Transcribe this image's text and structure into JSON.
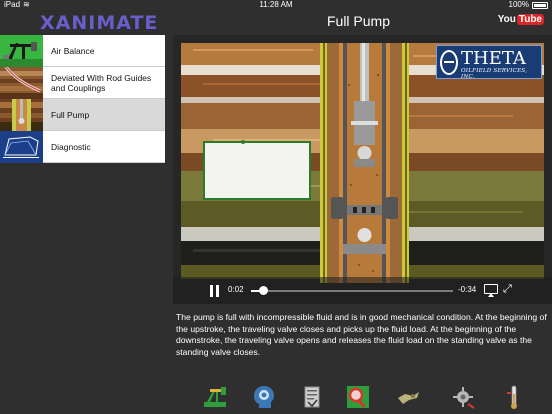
{
  "status": {
    "carrier": "iPad",
    "time": "11:28 AM",
    "battery": "100%"
  },
  "app": {
    "logo": "XANIMATE",
    "title": "Full Pump",
    "youtube_you": "You",
    "youtube_tube": "Tube"
  },
  "sidebar": {
    "items": [
      {
        "label": "Air Balance",
        "selected": false,
        "thumb_icon": "pump-jack-thumbnail"
      },
      {
        "label": "Deviated With Rod Guides and Couplings",
        "selected": false,
        "thumb_icon": "wellbore-thumbnail"
      },
      {
        "label": "Full Pump",
        "selected": true,
        "thumb_icon": "pump-thumbnail"
      },
      {
        "label": "Diagnostic",
        "selected": false,
        "thumb_icon": "dynagraph-thumbnail"
      }
    ]
  },
  "video": {
    "brand_big": "THETA",
    "brand_small": "OILFIELD SERVICES, INC.",
    "current_time": "0:02",
    "remaining_time": "-0:34",
    "progress": 0.06
  },
  "description": "The pump is full with incompressible fluid and is in good mechanical condition. At the beginning of the upstroke, the traveling valve closes and picks up the fluid load.  At the beginning of the downstroke, the traveling valve opens and releases the fluid load on the standing valve as the standing valve closes.",
  "toolbar": {
    "items": [
      {
        "icon": "pump-jack-icon",
        "color": "#2e9e3c"
      },
      {
        "icon": "head-profile-icon",
        "color": "#3a78b8"
      },
      {
        "icon": "document-icon",
        "color": "#cfcfcf"
      },
      {
        "icon": "magnifier-icon",
        "color": "#d9352b"
      },
      {
        "icon": "tool-icon",
        "color": "#b9b27a"
      },
      {
        "icon": "gear-wrench-icon",
        "color": "#b7b7b7"
      },
      {
        "icon": "gauge-icon",
        "color": "#d0a050"
      }
    ]
  },
  "colors": {
    "background": "#2f2f2f",
    "logo": "#6b5fc4",
    "selected_row": "#d9d9d9"
  }
}
